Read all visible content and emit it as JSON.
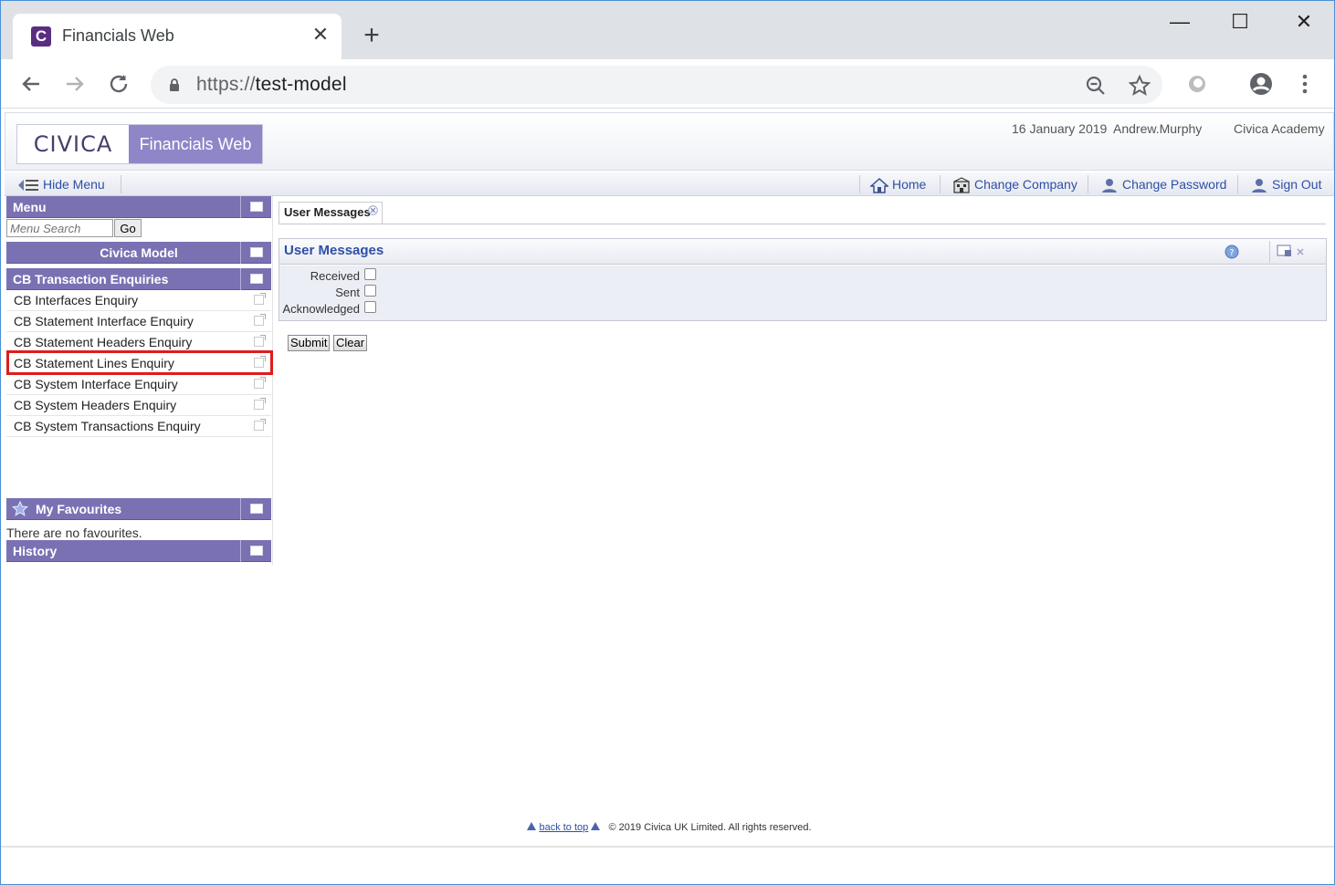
{
  "browser": {
    "tab_title": "Financials Web",
    "favicon_letter": "C",
    "url_scheme": "https://",
    "url_host": "test-model",
    "new_tab_symbol": "+",
    "close_symbol": "✕",
    "minimize_symbol": "—",
    "maximize_symbol": "☐",
    "window_close_symbol": "✕"
  },
  "header": {
    "logo_left": "CIVICA",
    "logo_right": "Financials Web",
    "date": "16 January 2019",
    "user": "Andrew.Murphy",
    "company": "Civica Academy"
  },
  "menubar": {
    "hide_menu": "Hide Menu",
    "home": "Home",
    "change_company": "Change Company",
    "change_password": "Change Password",
    "sign_out": "Sign Out"
  },
  "leftnav": {
    "menu_title": "Menu",
    "search_placeholder": "Menu Search",
    "go_label": "Go",
    "model_title": "Civica Model",
    "section_title": "CB Transaction Enquiries",
    "items": [
      "CB Interfaces Enquiry",
      "CB Statement Interface Enquiry",
      "CB Statement Headers Enquiry",
      "CB Statement Lines Enquiry",
      "CB System Interface Enquiry",
      "CB System Headers Enquiry",
      "CB System Transactions Enquiry"
    ],
    "favourites_title": "My Favourites",
    "no_favourites": "There are no favourites.",
    "history_title": "History"
  },
  "main": {
    "tab_label": "User Messages",
    "panel_title": "User Messages",
    "filters": [
      {
        "label": "Received",
        "checked": false
      },
      {
        "label": "Sent",
        "checked": false
      },
      {
        "label": "Acknowledged",
        "checked": false
      }
    ],
    "submit_label": "Submit",
    "clear_label": "Clear"
  },
  "footer": {
    "back_to_top": "back to top",
    "copyright": "© 2019 Civica UK Limited. All rights reserved."
  },
  "colors": {
    "accent": "#7a71b3",
    "link": "#2f4fa5",
    "highlight": "#e01b1b"
  }
}
